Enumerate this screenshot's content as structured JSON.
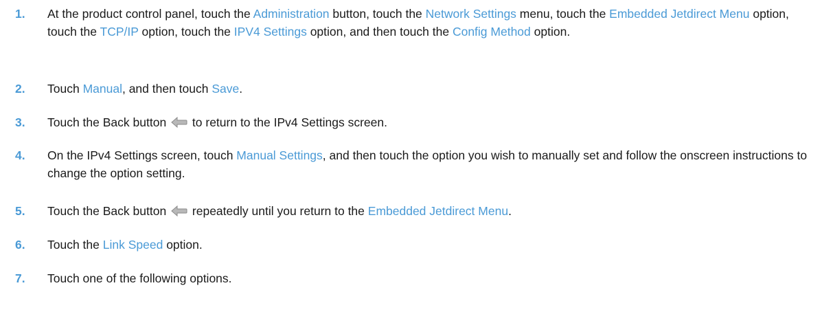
{
  "steps": [
    {
      "number": "1.",
      "segments": [
        {
          "t": "At the product control panel, touch the "
        },
        {
          "t": "Administration",
          "ui": true
        },
        {
          "t": " button, touch the "
        },
        {
          "t": "Network Settings",
          "ui": true
        },
        {
          "t": " menu, touch the "
        },
        {
          "t": "Embedded Jetdirect Menu",
          "ui": true
        },
        {
          "t": " option, touch the "
        },
        {
          "t": "TCP/IP",
          "ui": true
        },
        {
          "t": " option, touch the "
        },
        {
          "t": "IPV4 Settings",
          "ui": true
        },
        {
          "t": " option, and then touch the "
        },
        {
          "t": "Config Method",
          "ui": true
        },
        {
          "t": " option."
        }
      ]
    },
    {
      "number": "2.",
      "segments": [
        {
          "t": "Touch "
        },
        {
          "t": "Manual",
          "ui": true
        },
        {
          "t": ", and then touch "
        },
        {
          "t": "Save",
          "ui": true
        },
        {
          "t": "."
        }
      ]
    },
    {
      "number": "3.",
      "segments": [
        {
          "t": "Touch the Back button "
        },
        {
          "icon": "back-arrow-icon"
        },
        {
          "t": " to return to the IPv4 Settings screen."
        }
      ]
    },
    {
      "number": "4.",
      "segments": [
        {
          "t": "On the IPv4 Settings screen, touch "
        },
        {
          "t": "Manual Settings",
          "ui": true
        },
        {
          "t": ", and then touch the option you wish to manually set and follow the onscreen instructions to change the option setting."
        }
      ]
    },
    {
      "number": "5.",
      "segments": [
        {
          "t": "Touch the Back button "
        },
        {
          "icon": "back-arrow-icon"
        },
        {
          "t": " repeatedly until you return to the "
        },
        {
          "t": "Embedded Jetdirect Menu",
          "ui": true
        },
        {
          "t": "."
        }
      ]
    },
    {
      "number": "6.",
      "segments": [
        {
          "t": "Touch the "
        },
        {
          "t": "Link Speed",
          "ui": true
        },
        {
          "t": " option."
        }
      ]
    },
    {
      "number": "7.",
      "segments": [
        {
          "t": "Touch one of the following options."
        }
      ]
    }
  ],
  "colors": {
    "accent": "#4a9ad6",
    "text": "#1a1a1a"
  }
}
